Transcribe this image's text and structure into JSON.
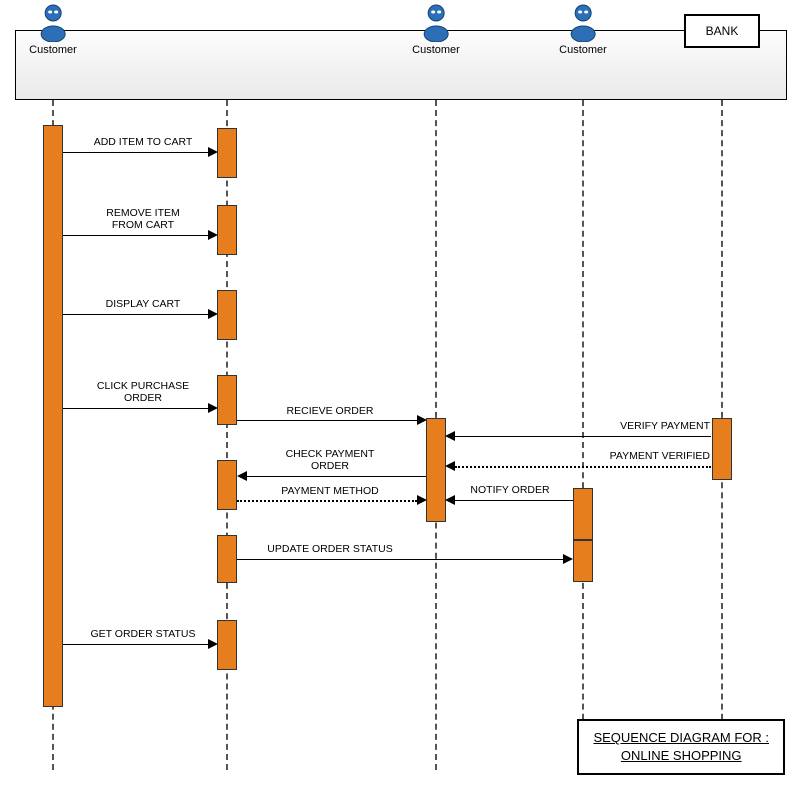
{
  "title_line1": "SEQUENCE DIAGRAM FOR :",
  "title_line2": "ONLINE SHOPPING",
  "actors": {
    "a1": "Customer",
    "a2": "Customer",
    "a3": "Customer",
    "bank": "BANK"
  },
  "messages": {
    "add": "ADD ITEM TO CART",
    "remove_l1": "REMOVE ITEM",
    "remove_l2": "FROM CART",
    "display": "DISPLAY CART",
    "purchase_l1": "CLICK PURCHASE",
    "purchase_l2": "ORDER",
    "receive": "RECIEVE ORDER",
    "verify": "VERIFY PAYMENT",
    "check_l1": "CHECK PAYMENT",
    "check_l2": "ORDER",
    "payverified": "PAYMENT VERIFIED",
    "method": "PAYMENT METHOD",
    "notify": "NOTIFY ORDER",
    "update": "UPDATE ORDER STATUS",
    "getstatus": "GET ORDER STATUS"
  }
}
